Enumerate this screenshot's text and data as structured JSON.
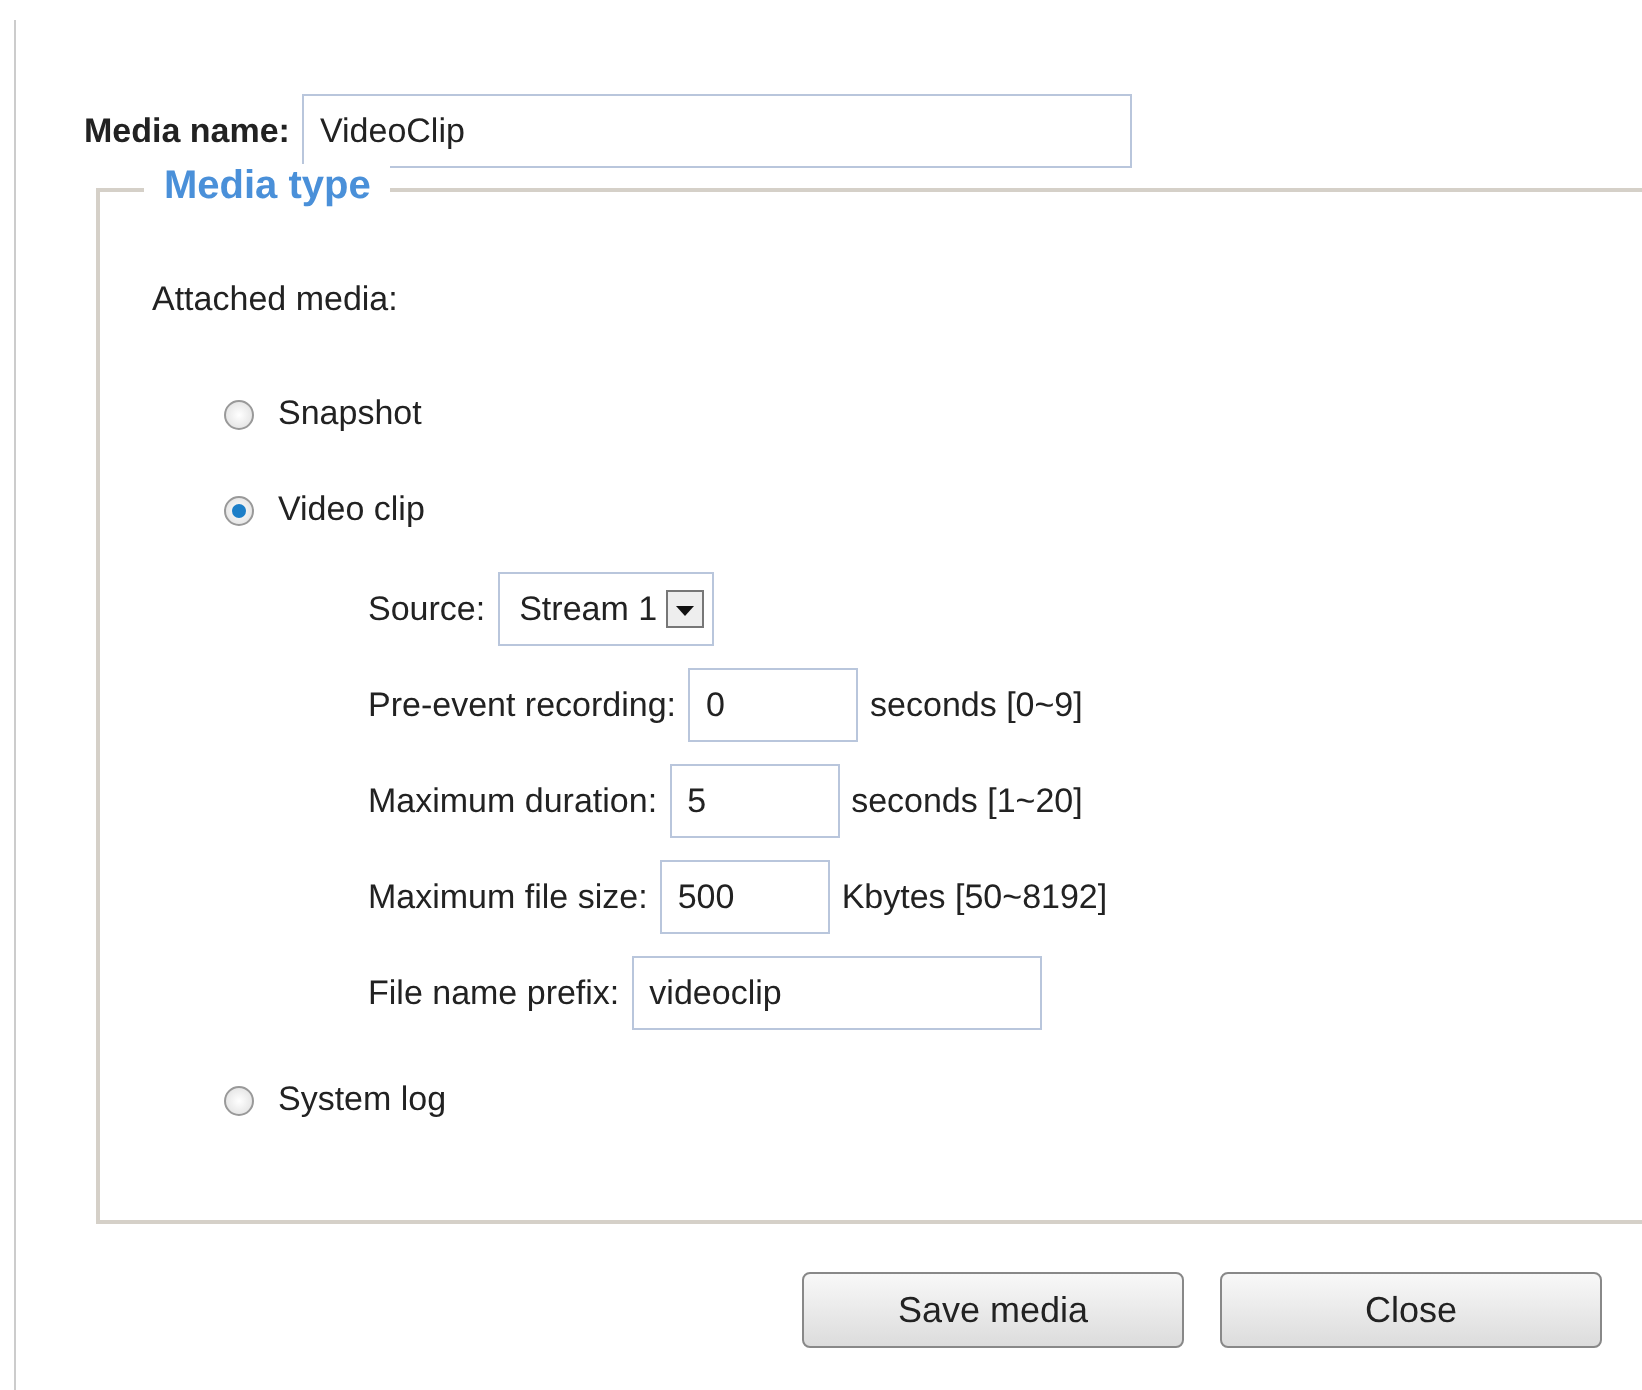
{
  "media_name": {
    "label": "Media name:",
    "value": "VideoClip"
  },
  "media_type": {
    "legend": "Media type",
    "attached_label": "Attached media:",
    "options": [
      {
        "label": "Snapshot",
        "selected": false
      },
      {
        "label": "Video clip",
        "selected": true,
        "fields": [
          {
            "kind": "select",
            "label": "Source:",
            "value": "Stream 1"
          },
          {
            "kind": "text",
            "label": "Pre-event recording:",
            "value": "0",
            "hint": "seconds [0~9]"
          },
          {
            "kind": "text",
            "label": "Maximum duration:",
            "value": "5",
            "hint": "seconds [1~20]"
          },
          {
            "kind": "text",
            "label": "Maximum file size:",
            "value": "500",
            "hint": "Kbytes [50~8192]"
          },
          {
            "kind": "wide",
            "label": "File name prefix:",
            "value": "videoclip"
          }
        ]
      },
      {
        "label": "System log",
        "selected": false
      }
    ]
  },
  "buttons": [
    "Save media",
    "Close"
  ]
}
